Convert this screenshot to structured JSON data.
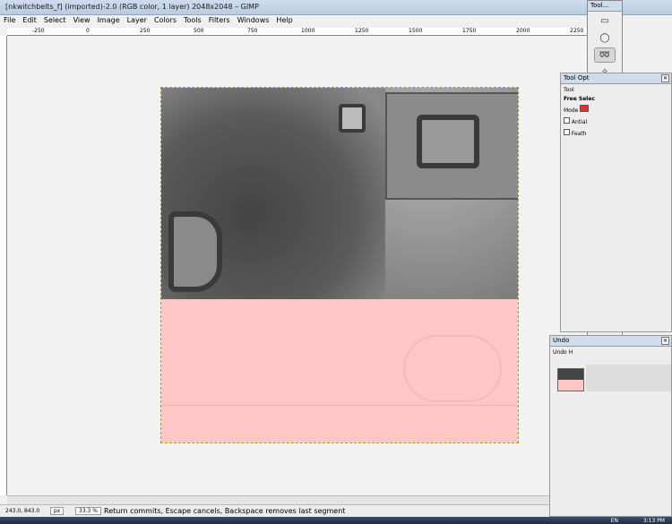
{
  "window": {
    "title": "[nkwitchbelts_f] (imported)-2.0 (RGB color, 1 layer) 2048x2048 – GIMP"
  },
  "menu": [
    "File",
    "Edit",
    "Select",
    "View",
    "Image",
    "Layer",
    "Colors",
    "Tools",
    "Filters",
    "Windows",
    "Help"
  ],
  "ruler": {
    "ticks": [
      "-250",
      "0",
      "250",
      "500",
      "750",
      "1000",
      "1250",
      "1500",
      "1750",
      "2000",
      "2250"
    ]
  },
  "status": {
    "coords": "243.0, 843.0",
    "unit": "px",
    "zoom": "33.3 %",
    "message": "Return commits, Escape cancels, Backspace removes last segment"
  },
  "toolbox": {
    "title": "Tool..."
  },
  "tool_options": {
    "title": "Tool Opt",
    "tab": "Tool",
    "heading": "Free Selec",
    "mode_label": "Mode",
    "antialias": "Antial",
    "feather": "Feath"
  },
  "undo": {
    "title": "Undo",
    "item": "Undo H"
  },
  "taskbar": {
    "lang": "EN",
    "time": "3:13 PM"
  },
  "colors": {
    "pink": "#ffc6c6",
    "dark": "#6a6a6a"
  }
}
